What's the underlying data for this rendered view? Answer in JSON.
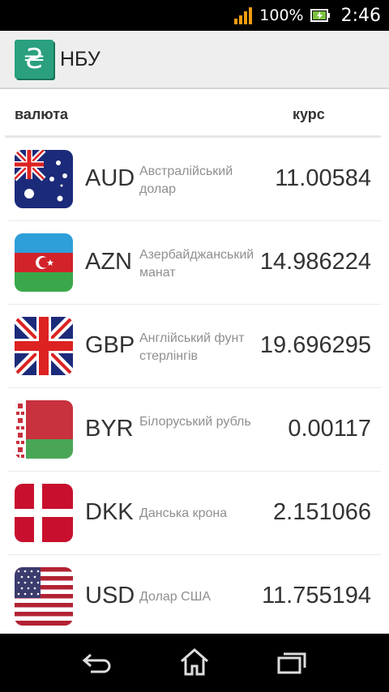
{
  "status_bar": {
    "battery_percent": "100%",
    "time": "2:46",
    "signal_icon": "signal-bars-icon",
    "battery_icon": "battery-charging-icon"
  },
  "app_bar": {
    "icon": "hryvnia-icon",
    "icon_glyph": "₴",
    "title": "НБУ"
  },
  "columns": {
    "currency": "валюта",
    "rate": "курс"
  },
  "rates": [
    {
      "code": "AUD",
      "name": "Австралійський долар",
      "rate": "11.00584",
      "flag": "australia-flag-icon"
    },
    {
      "code": "AZN",
      "name": "Азербайджанський манат",
      "rate": "14.986224",
      "flag": "azerbaijan-flag-icon"
    },
    {
      "code": "GBP",
      "name": "Англійський фунт стерлінгів",
      "rate": "19.696295",
      "flag": "uk-flag-icon"
    },
    {
      "code": "BYR",
      "name": "Білоруський рубль",
      "rate": "0.00117",
      "flag": "belarus-flag-icon"
    },
    {
      "code": "DKK",
      "name": "Данська крона",
      "rate": "2.151066",
      "flag": "denmark-flag-icon"
    },
    {
      "code": "USD",
      "name": "Долар США",
      "rate": "11.755194",
      "flag": "usa-flag-icon"
    }
  ],
  "nav_bar": {
    "back_icon": "back-icon",
    "home_icon": "home-icon",
    "recents_icon": "recent-apps-icon"
  }
}
